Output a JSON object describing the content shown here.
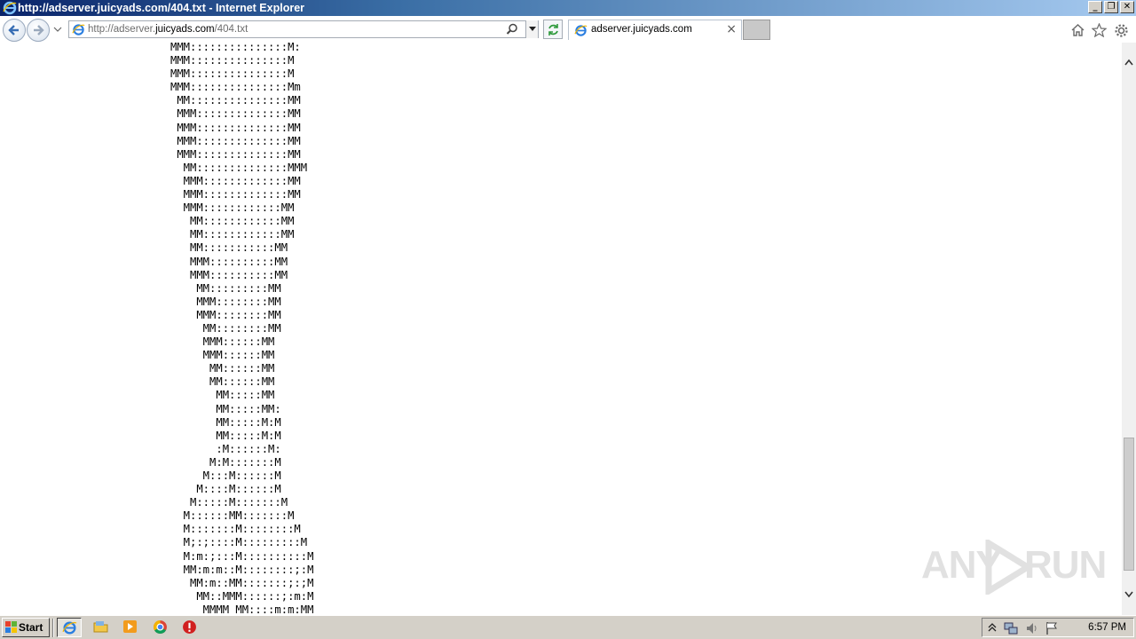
{
  "window": {
    "title": "http://adserver.juicyads.com/404.txt - Internet Explorer",
    "buttons": [
      "minimize",
      "restore",
      "close"
    ]
  },
  "navbar": {
    "url_prefix": "http://adserver.",
    "url_domain": "juicyads.com",
    "url_path": "/404.txt",
    "tab_label": "adserver.juicyads.com",
    "tab_close": "×"
  },
  "content": {
    "ascii_lines": [
      "MMM:::::::::::::::M:",
      "MMM:::::::::::::::M",
      "MMM:::::::::::::::M",
      "MMM:::::::::::::::Mm",
      " MM:::::::::::::::MM",
      " MMM::::::::::::::MM",
      " MMM::::::::::::::MM",
      " MMM::::::::::::::MM",
      " MMM::::::::::::::MM",
      "  MM::::::::::::::MMM",
      "  MMM:::::::::::::MM",
      "  MMM:::::::::::::MM",
      "  MMM::::::::::::MM",
      "   MM::::::::::::MM",
      "   MM::::::::::::MM",
      "   MM:::::::::::MM",
      "   MMM::::::::::MM",
      "   MMM::::::::::MM",
      "    MM:::::::::MM",
      "    MMM::::::::MM",
      "    MMM::::::::MM",
      "     MM::::::::MM",
      "     MMM::::::MM",
      "     MMM::::::MM",
      "      MM::::::MM",
      "      MM::::::MM",
      "       MM:::::MM",
      "       MM:::::MM:",
      "       MM:::::M:M",
      "       MM:::::M:M",
      "       :M::::::M:",
      "      M:M:::::::M",
      "     M:::M::::::M",
      "    M::::M::::::M",
      "   M:::::M:::::::M",
      "  M::::::MM:::::::M",
      "  M:::::::M::::::::M",
      "  M;:;::::M:::::::::M",
      "  M:m:;:::M::::::::::M",
      "  MM:m:m::M::::::::;:M",
      "   MM:m::MM:::::::;:;M",
      "    MM::MMM::::::;:m:M",
      "     MMMM MM::::m:m:MM"
    ]
  },
  "taskbar": {
    "start_label": "Start",
    "clock": "6:57 PM"
  },
  "watermark": {
    "text_left": "ANY",
    "text_right": "RUN"
  },
  "colors": {
    "titlebar_start": "#0a246a",
    "titlebar_end": "#a6caf0",
    "taskbar": "#d4d0c8"
  }
}
